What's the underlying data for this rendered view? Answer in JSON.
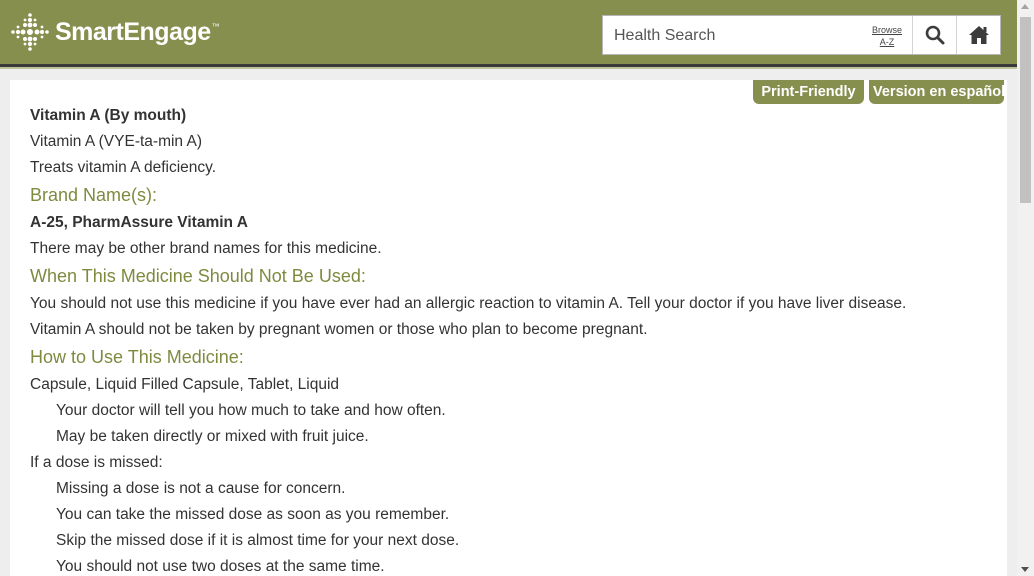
{
  "brand": {
    "name": "SmartEngage",
    "tm": "™"
  },
  "search": {
    "placeholder": "Health Search",
    "browse_line1": "Browse",
    "browse_line2": "A-Z"
  },
  "icons": {
    "search": "search-icon",
    "home": "home-icon",
    "logo": "cross-dots-logo-icon"
  },
  "colors": {
    "header": "#868f4e",
    "heading": "#7f8a3f",
    "button": "#868f4e"
  },
  "actions": {
    "print": "Print-Friendly",
    "spanish": "Version en español"
  },
  "article": {
    "title": "Vitamin A (By mouth)",
    "pronunciation": "Vitamin A (VYE-ta-min A)",
    "summary": "Treats vitamin A deficiency.",
    "brand_heading": "Brand Name(s):",
    "brands": "A-25, PharmAssure Vitamin A",
    "brand_note": "There may be other brand names for this medicine.",
    "not_used_heading": "When This Medicine Should Not Be Used:",
    "not_used_1": "You should not use this medicine if you have ever had an allergic reaction to vitamin A. Tell your doctor if you have liver disease.",
    "not_used_2": "Vitamin A should not be taken by pregnant women or those who plan to become pregnant.",
    "how_heading": "How to Use This Medicine:",
    "forms": "Capsule, Liquid Filled Capsule, Tablet, Liquid",
    "how_1": "Your doctor will tell you how much to take and how often.",
    "how_2": "May be taken directly or mixed with fruit juice.",
    "missed_label": "If a dose is missed:",
    "missed_1": "Missing a dose is not a cause for concern.",
    "missed_2": "You can take the missed dose as soon as you remember.",
    "missed_3": "Skip the missed dose if it is almost time for your next dose.",
    "missed_4": "You should not use two doses at the same time."
  }
}
